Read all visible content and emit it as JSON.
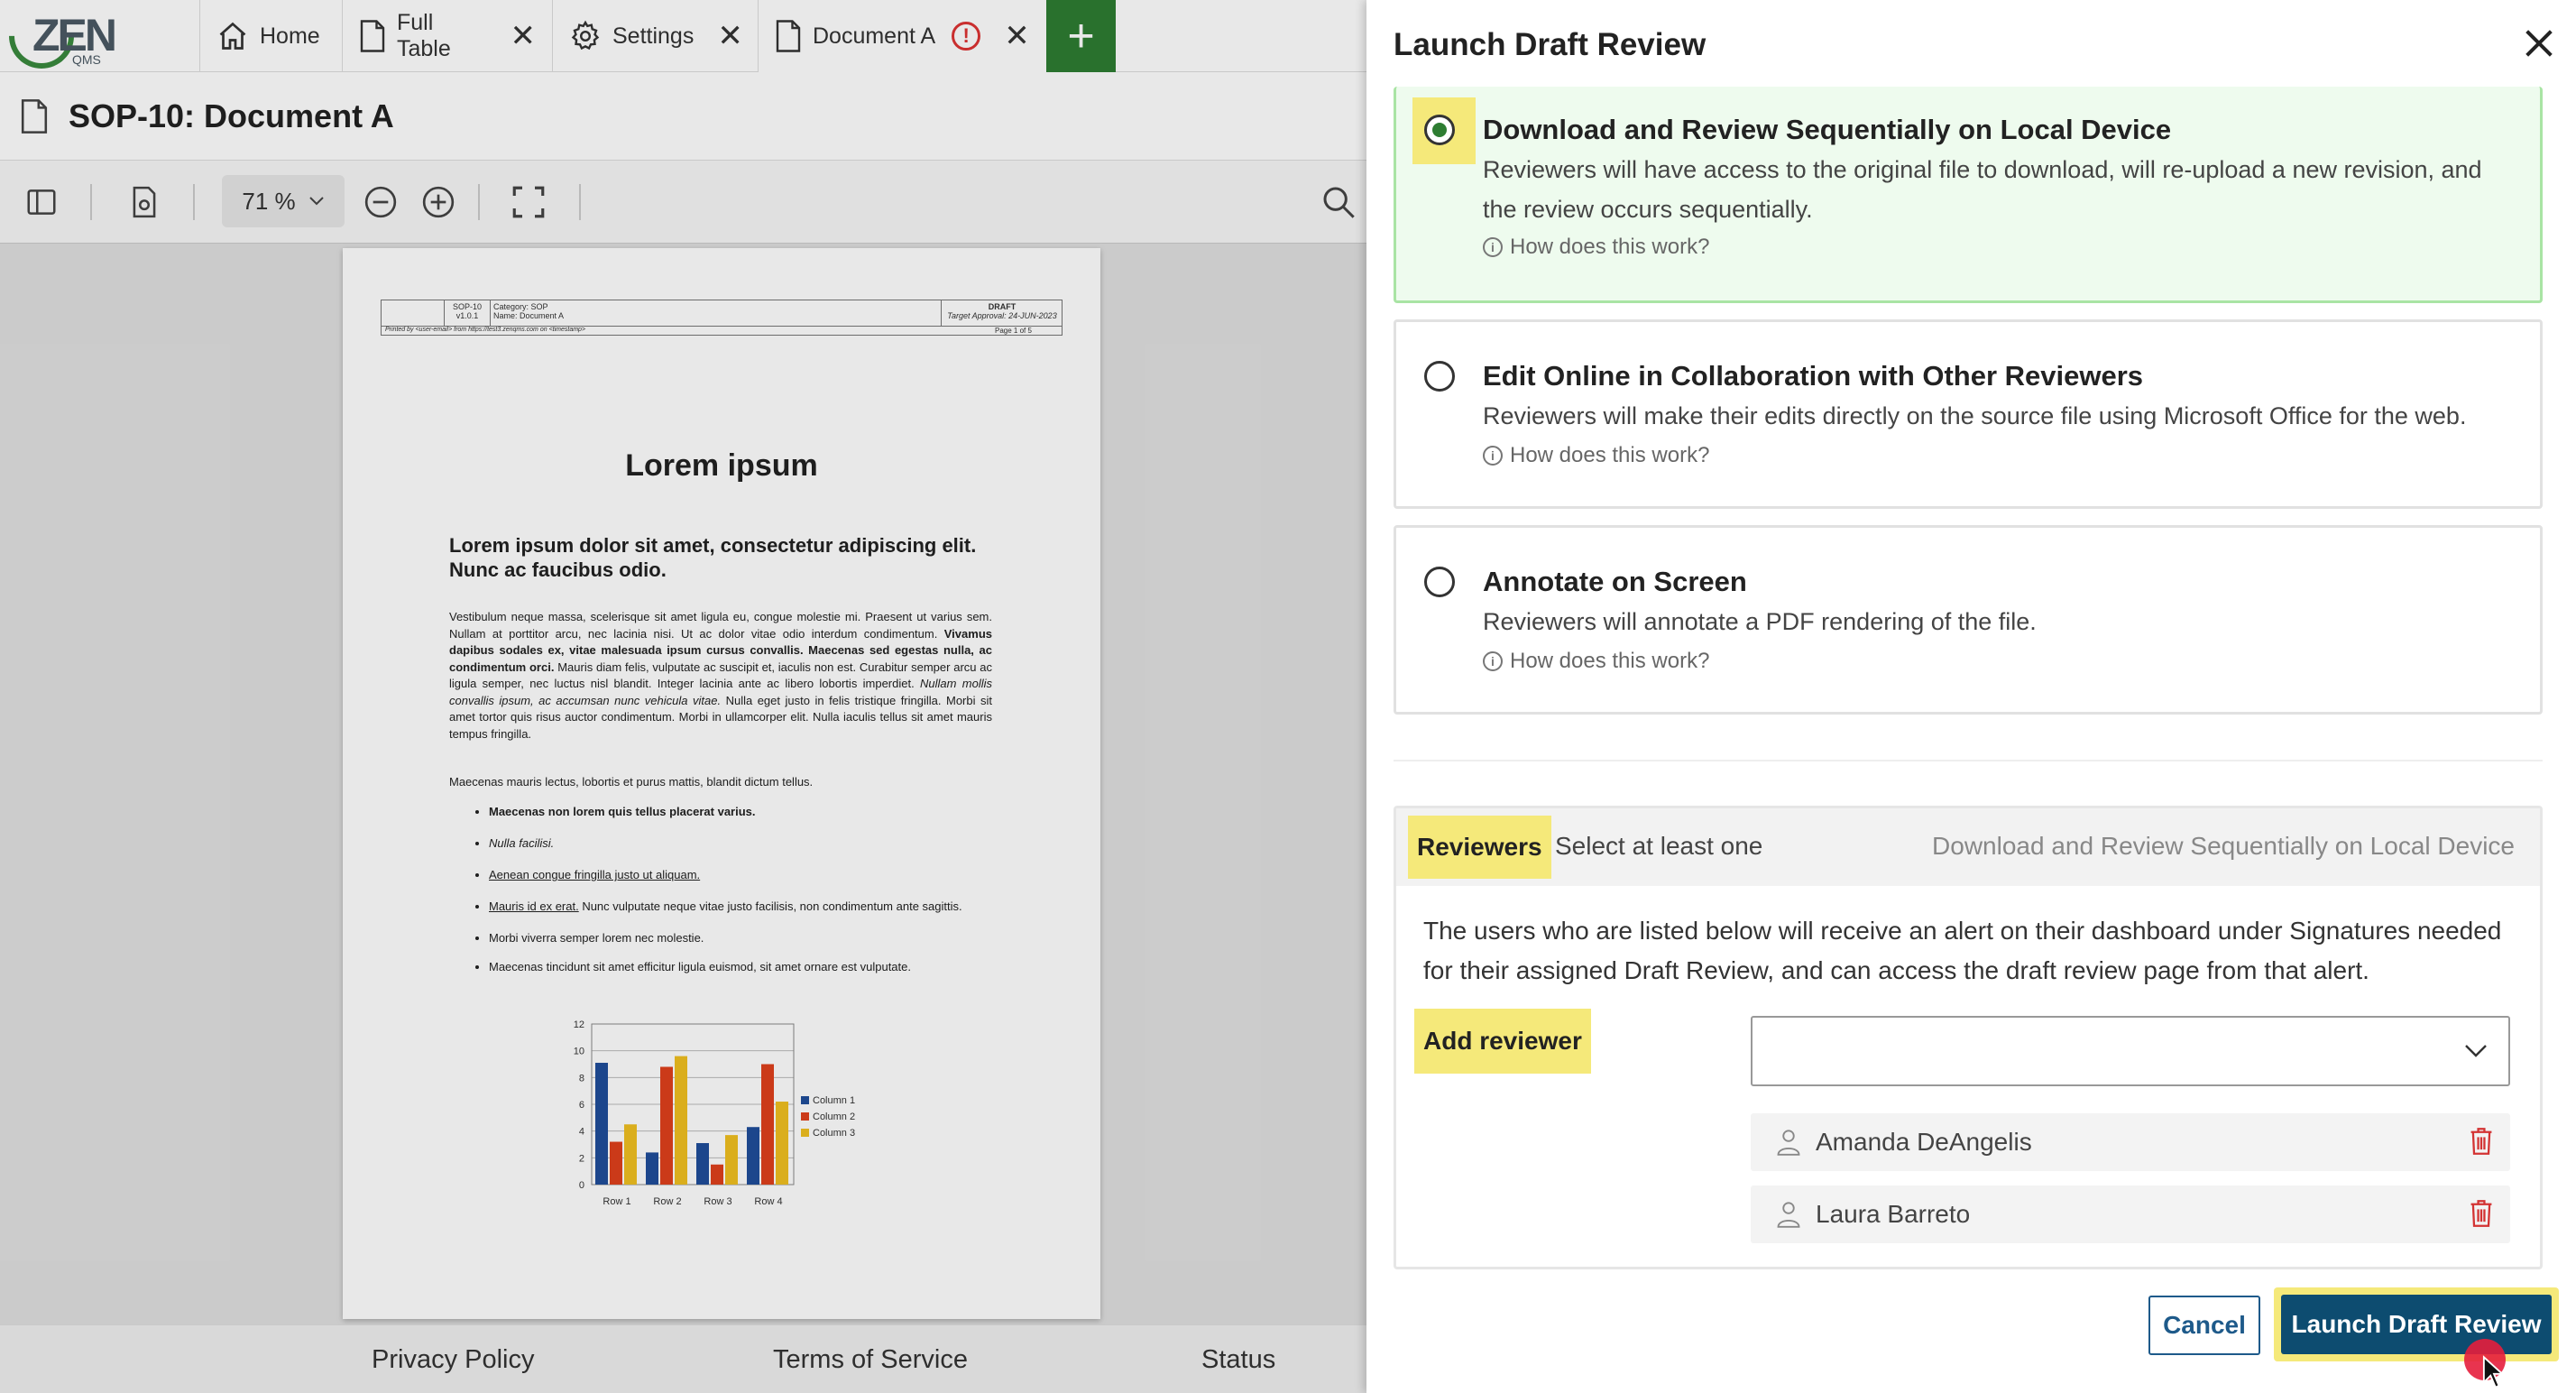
{
  "tabs": {
    "logo": {
      "zen": "ZEN",
      "qms": "QMS"
    },
    "items": [
      {
        "label": "Home",
        "icon": "home-icon"
      },
      {
        "label": "Full Table",
        "icon": "document-icon"
      },
      {
        "label": "Settings",
        "icon": "gear-icon"
      },
      {
        "label": "Document A",
        "icon": "document-icon",
        "alert": "!"
      }
    ],
    "add_label": "+"
  },
  "document": {
    "title": "SOP-10: Document A",
    "zoom": "71 %",
    "page": {
      "header": {
        "id": "SOP-10",
        "version": "v1.0.1",
        "category": "Category: SOP",
        "name": "Name: Document A",
        "status": "DRAFT",
        "target": "Target Approval: 24-JUN-2023",
        "printed": "Printed by <user-email> from https://test3.zenqms.com on <timestamp>",
        "page_of": "Page 1 of 5"
      },
      "heading": "Lorem ipsum",
      "subheading": "Lorem ipsum dolor sit amet, consectetur adipiscing elit. Nunc ac faucibus odio.",
      "para1_a": "Vestibulum neque massa, scelerisque sit amet ligula eu, congue molestie mi. Praesent ut varius sem. Nullam at porttitor arcu, nec lacinia nisi. Ut ac dolor vitae odio interdum condimentum. ",
      "para1_b": "Vivamus dapibus sodales ex, vitae malesuada ipsum cursus convallis. Maecenas sed egestas nulla, ac condimentum orci.",
      "para1_c": " Mauris diam felis, vulputate ac suscipit et, iaculis non est. Curabitur semper arcu ac ligula semper, nec luctus nisl blandit. Integer lacinia ante ac libero lobortis imperdiet. ",
      "para1_d": "Nullam mollis convallis ipsum, ac accumsan nunc vehicula vitae.",
      "para1_e": " Nulla eget justo in felis tristique fringilla. Morbi sit amet tortor quis risus auctor condimentum. Morbi in ullamcorper elit. Nulla iaculis tellus sit amet mauris tempus fringilla.",
      "para2": "Maecenas mauris lectus, lobortis et purus mattis, blandit dictum tellus.",
      "list": {
        "b1": "Maecenas non lorem quis tellus placerat varius.",
        "b2": "Nulla facilisi.",
        "b3": "Aenean congue fringilla justo ut aliquam.",
        "b4_link": "Mauris id ex erat.",
        "b4_rest": " Nunc vulputate neque vitae justo facilisis, non condimentum ante sagittis.",
        "b5": "Morbi viverra semper lorem nec molestie.",
        "b6": "Maecenas tincidunt sit amet efficitur ligula euismod, sit amet ornare est vulputate."
      }
    }
  },
  "chart_data": {
    "type": "bar",
    "categories": [
      "Row 1",
      "Row 2",
      "Row 3",
      "Row 4"
    ],
    "series": [
      {
        "name": "Column 1",
        "values": [
          9.1,
          2.4,
          3.1,
          4.3
        ],
        "color": "#1f4e9a"
      },
      {
        "name": "Column 2",
        "values": [
          3.2,
          8.8,
          1.5,
          9.0
        ],
        "color": "#e0401c"
      },
      {
        "name": "Column 3",
        "values": [
          4.5,
          9.6,
          3.7,
          6.2
        ],
        "color": "#f0c020"
      }
    ],
    "yticks": [
      "0",
      "2",
      "4",
      "6",
      "8",
      "10",
      "12"
    ],
    "ylim": [
      0,
      12
    ],
    "grid": true,
    "legend": "right"
  },
  "footer": {
    "privacy": "Privacy Policy",
    "terms": "Terms of Service",
    "status": "Status"
  },
  "drawer": {
    "title": "Launch Draft Review",
    "options": [
      {
        "title": "Download and Review Sequentially on Local Device",
        "desc": "Reviewers will have access to the original file to download, will re-upload a new revision, and the review occurs sequentially.",
        "how": "How does this work?",
        "selected": true
      },
      {
        "title": "Edit Online in Collaboration with Other Reviewers",
        "desc": "Reviewers will make their edits directly on the source file using Microsoft Office for the web.",
        "how": "How does this work?",
        "selected": false
      },
      {
        "title": "Annotate on Screen",
        "desc": "Reviewers will annotate a PDF rendering of the file.",
        "how": "How does this work?",
        "selected": false
      }
    ],
    "reviewers": {
      "label": "Reviewers",
      "hint": "Select at least one",
      "mode": "Download and Review Sequentially on Local Device",
      "note": "The users who are listed below will receive an alert on their dashboard under Signatures needed for their assigned Draft Review, and can access the draft review page from that alert.",
      "add_label": "Add reviewer",
      "list": [
        {
          "name": "Amanda DeAngelis"
        },
        {
          "name": "Laura Barreto"
        }
      ]
    },
    "cancel": "Cancel",
    "launch": "Launch Draft Review"
  },
  "colors": {
    "brand_green": "#2e7d32",
    "highlight": "#f5e97a",
    "primary_button": "#0d4c70",
    "delete_red": "#d33333"
  }
}
